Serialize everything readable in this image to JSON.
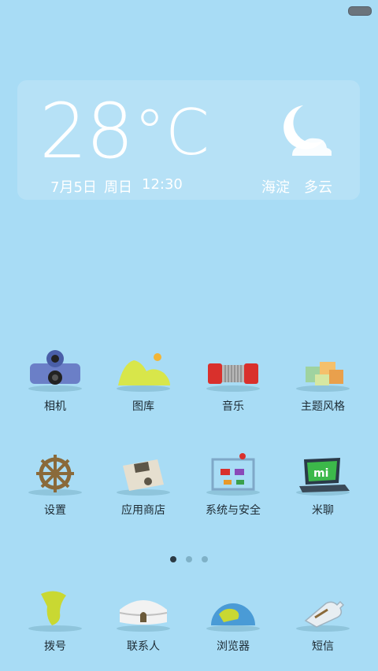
{
  "weather": {
    "temperature": "28",
    "unit": "°C",
    "date": "7月5日",
    "weekday": "周日",
    "time": "12:30",
    "location": "海淀",
    "condition": "多云",
    "icon": "moon-cloud-icon"
  },
  "page_indicator": {
    "count": 3,
    "active_index": 0
  },
  "apps_row1": [
    {
      "label": "相机",
      "icon": "camera-icon"
    },
    {
      "label": "图库",
      "icon": "gallery-icon"
    },
    {
      "label": "音乐",
      "icon": "music-accordion-icon"
    },
    {
      "label": "主题风格",
      "icon": "themes-cubes-icon"
    }
  ],
  "apps_row2": [
    {
      "label": "设置",
      "icon": "ship-wheel-icon"
    },
    {
      "label": "应用商店",
      "icon": "floppy-disk-icon"
    },
    {
      "label": "系统与安全",
      "icon": "security-frame-icon"
    },
    {
      "label": "米聊",
      "icon": "mi-laptop-icon"
    }
  ],
  "dock": [
    {
      "label": "拨号",
      "icon": "phone-handset-icon"
    },
    {
      "label": "联系人",
      "icon": "contacts-yurt-icon"
    },
    {
      "label": "浏览器",
      "icon": "globe-icon"
    },
    {
      "label": "短信",
      "icon": "message-bottle-icon"
    }
  ],
  "colors": {
    "background": "#a8dcf5",
    "text": "#1d2b34",
    "weather_text": "#ffffff"
  }
}
